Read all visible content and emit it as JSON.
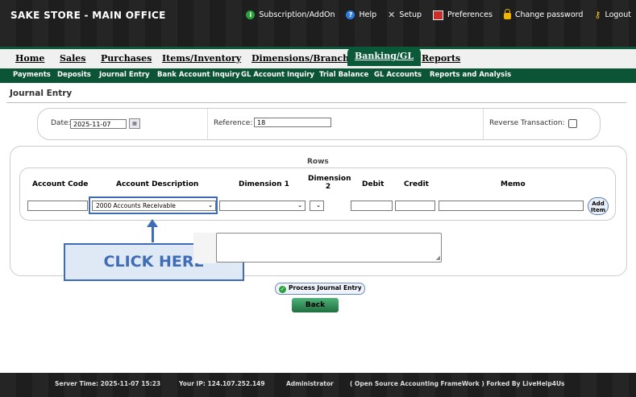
{
  "app": {
    "title": "SAKE STORE - MAIN OFFICE"
  },
  "toplinks": [
    {
      "label": "Subscription/AddOn",
      "icon": "info-green-icon"
    },
    {
      "label": "Help",
      "icon": "help-icon"
    },
    {
      "label": "Setup",
      "icon": "tools-icon"
    },
    {
      "label": "Preferences",
      "icon": "preferences-icon"
    },
    {
      "label": "Change password",
      "icon": "lock-icon"
    },
    {
      "label": "Logout",
      "icon": "key-icon"
    }
  ],
  "mainmenu": [
    "Home",
    "Sales",
    "Purchases",
    "Items/Inventory",
    "Dimensions/Branch",
    "Banking/GL",
    "Reports"
  ],
  "mainmenu_active": "Banking/GL",
  "submenu": [
    "Payments",
    "Deposits",
    "Journal Entry",
    "Bank Account Inquiry",
    "GL Account Inquiry",
    "Trial Balance",
    "GL Accounts",
    "Reports and Analysis"
  ],
  "page": {
    "title": "Journal Entry"
  },
  "header": {
    "date_label": "Date:",
    "date_value": "2025-11-07",
    "reference_label": "Reference:",
    "reference_value": "18",
    "reverse_label": "Reverse Transaction:"
  },
  "rows": {
    "title": "Rows",
    "columns": {
      "account_code": "Account Code",
      "account_description": "Account Description",
      "dimension1": "Dimension 1",
      "dimension2_line1": "Dimension",
      "dimension2_line2": "2",
      "debit": "Debit",
      "credit": "Credit",
      "memo": "Memo"
    },
    "account_selected": "2000   Accounts Receivable",
    "add_item_line1": "Add",
    "add_item_line2": "Item"
  },
  "annotation": {
    "text": "CLICK HERE"
  },
  "buttons": {
    "process": "Process Journal Entry",
    "back": "Back"
  },
  "footer": {
    "server_time": "Server Time: 2025-11-07 15:23",
    "ip": "Your IP: 124.107.252.149",
    "user": "Administrator",
    "credit": "( Open Source Accounting FrameWork ) Forked By LiveHelp4Us"
  },
  "colors": {
    "header_bg": "#1e1e1e",
    "menu_green": "#0a5a3a",
    "annotation_blue": "#3e6db5"
  }
}
